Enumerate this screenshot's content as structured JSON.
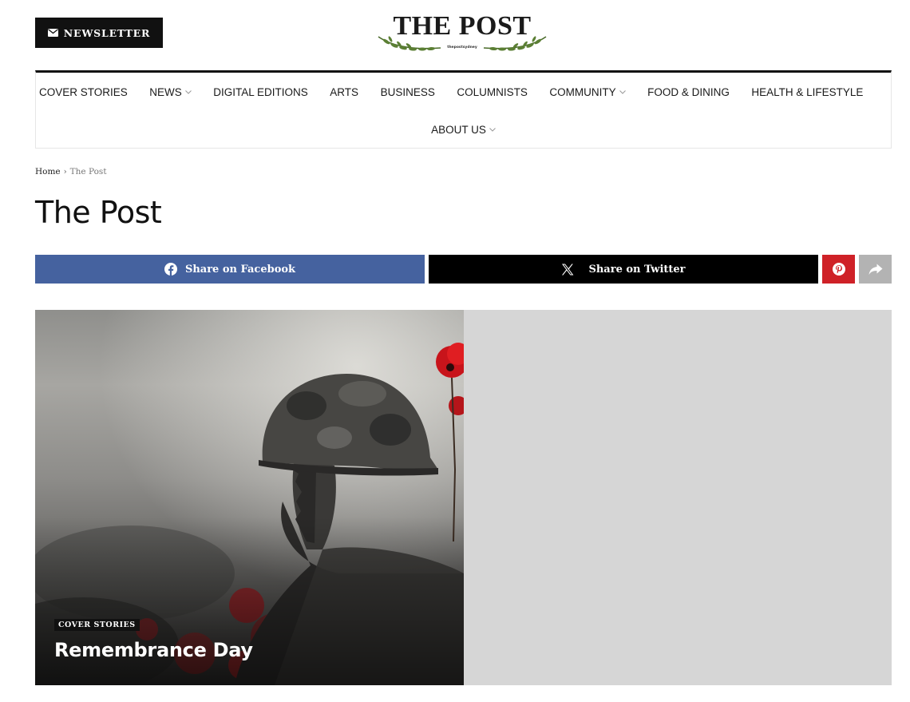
{
  "header": {
    "newsletter_label": "NEWSLETTER",
    "newsletter_icon": "envelope-icon",
    "logo_title": "THE POST",
    "logo_tagline": "thepostsydney"
  },
  "nav": {
    "row1": [
      {
        "label": "COVER STORIES",
        "has_dropdown": false
      },
      {
        "label": "NEWS",
        "has_dropdown": true
      },
      {
        "label": "DIGITAL EDITIONS",
        "has_dropdown": false
      },
      {
        "label": "ARTS",
        "has_dropdown": false
      },
      {
        "label": "BUSINESS",
        "has_dropdown": false
      },
      {
        "label": "COLUMNISTS",
        "has_dropdown": false
      },
      {
        "label": "COMMUNITY",
        "has_dropdown": true
      },
      {
        "label": "FOOD & DINING",
        "has_dropdown": false
      },
      {
        "label": "HEALTH & LIFESTYLE",
        "has_dropdown": false
      }
    ],
    "row2": [
      {
        "label": "ABOUT US",
        "has_dropdown": true
      }
    ]
  },
  "breadcrumb": {
    "home": "Home",
    "separator": "›",
    "current": "The Post"
  },
  "page": {
    "title": "The Post"
  },
  "share": {
    "facebook_label": "Share on Facebook",
    "twitter_label": "Share on Twitter",
    "colors": {
      "facebook": "#45629f",
      "twitter": "#000000",
      "pinterest": "#cf2127",
      "more": "#b3b3b3"
    }
  },
  "featured": {
    "category": "COVER STORIES",
    "title": "Remembrance Day"
  }
}
